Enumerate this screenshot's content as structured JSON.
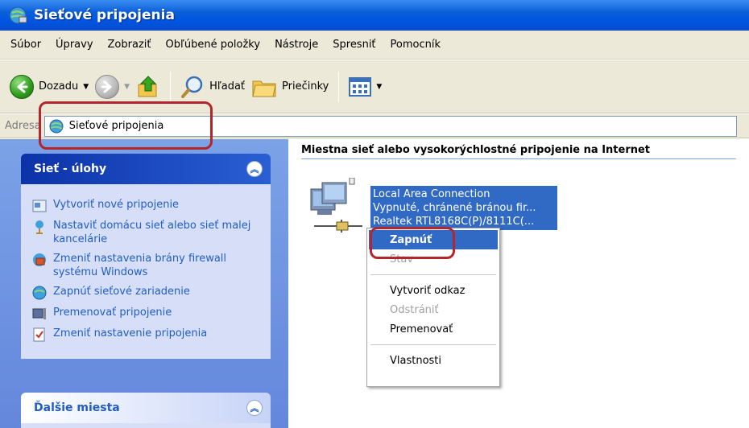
{
  "window": {
    "title": "Sieťové pripojenia"
  },
  "menu": [
    "Súbor",
    "Úpravy",
    "Zobraziť",
    "Obľúbené položky",
    "Nástroje",
    "Spresniť",
    "Pomocník"
  ],
  "toolbar": {
    "back": "Dozadu",
    "search": "Hľadať",
    "folders": "Priečinky"
  },
  "address": {
    "label": "Adresa",
    "value": "Sieťové pripojenia"
  },
  "taskpane": {
    "tasks_title": "Sieť - úlohy",
    "tasks": [
      "Vytvoriť nové pripojenie",
      "Nastaviť domácu sieť alebo sieť malej kancelárie",
      "Zmeniť nastavenia brány firewall systému Windows",
      "Zapnúť sieťové zariadenie",
      "Premenovať pripojenie",
      "Zmeniť nastavenie pripojenia"
    ],
    "other_title": "Ďalšie miesta"
  },
  "content": {
    "group_title": "Miestna sieť alebo vysokorýchlostné pripojenie na Internet",
    "connection": {
      "name": "Local Area Connection",
      "status": "Vypnuté, chránené bránou fir...",
      "device": "Realtek RTL8168C(P)/8111C(..."
    }
  },
  "context_menu": {
    "items": [
      "Zapnúť",
      "Stav",
      "Vytvoriť odkaz",
      "Odstrániť",
      "Premenovať",
      "Vlastnosti"
    ]
  },
  "colors": {
    "highlight": "#316ac5",
    "callout": "#b3262b",
    "link": "#215dc6"
  }
}
